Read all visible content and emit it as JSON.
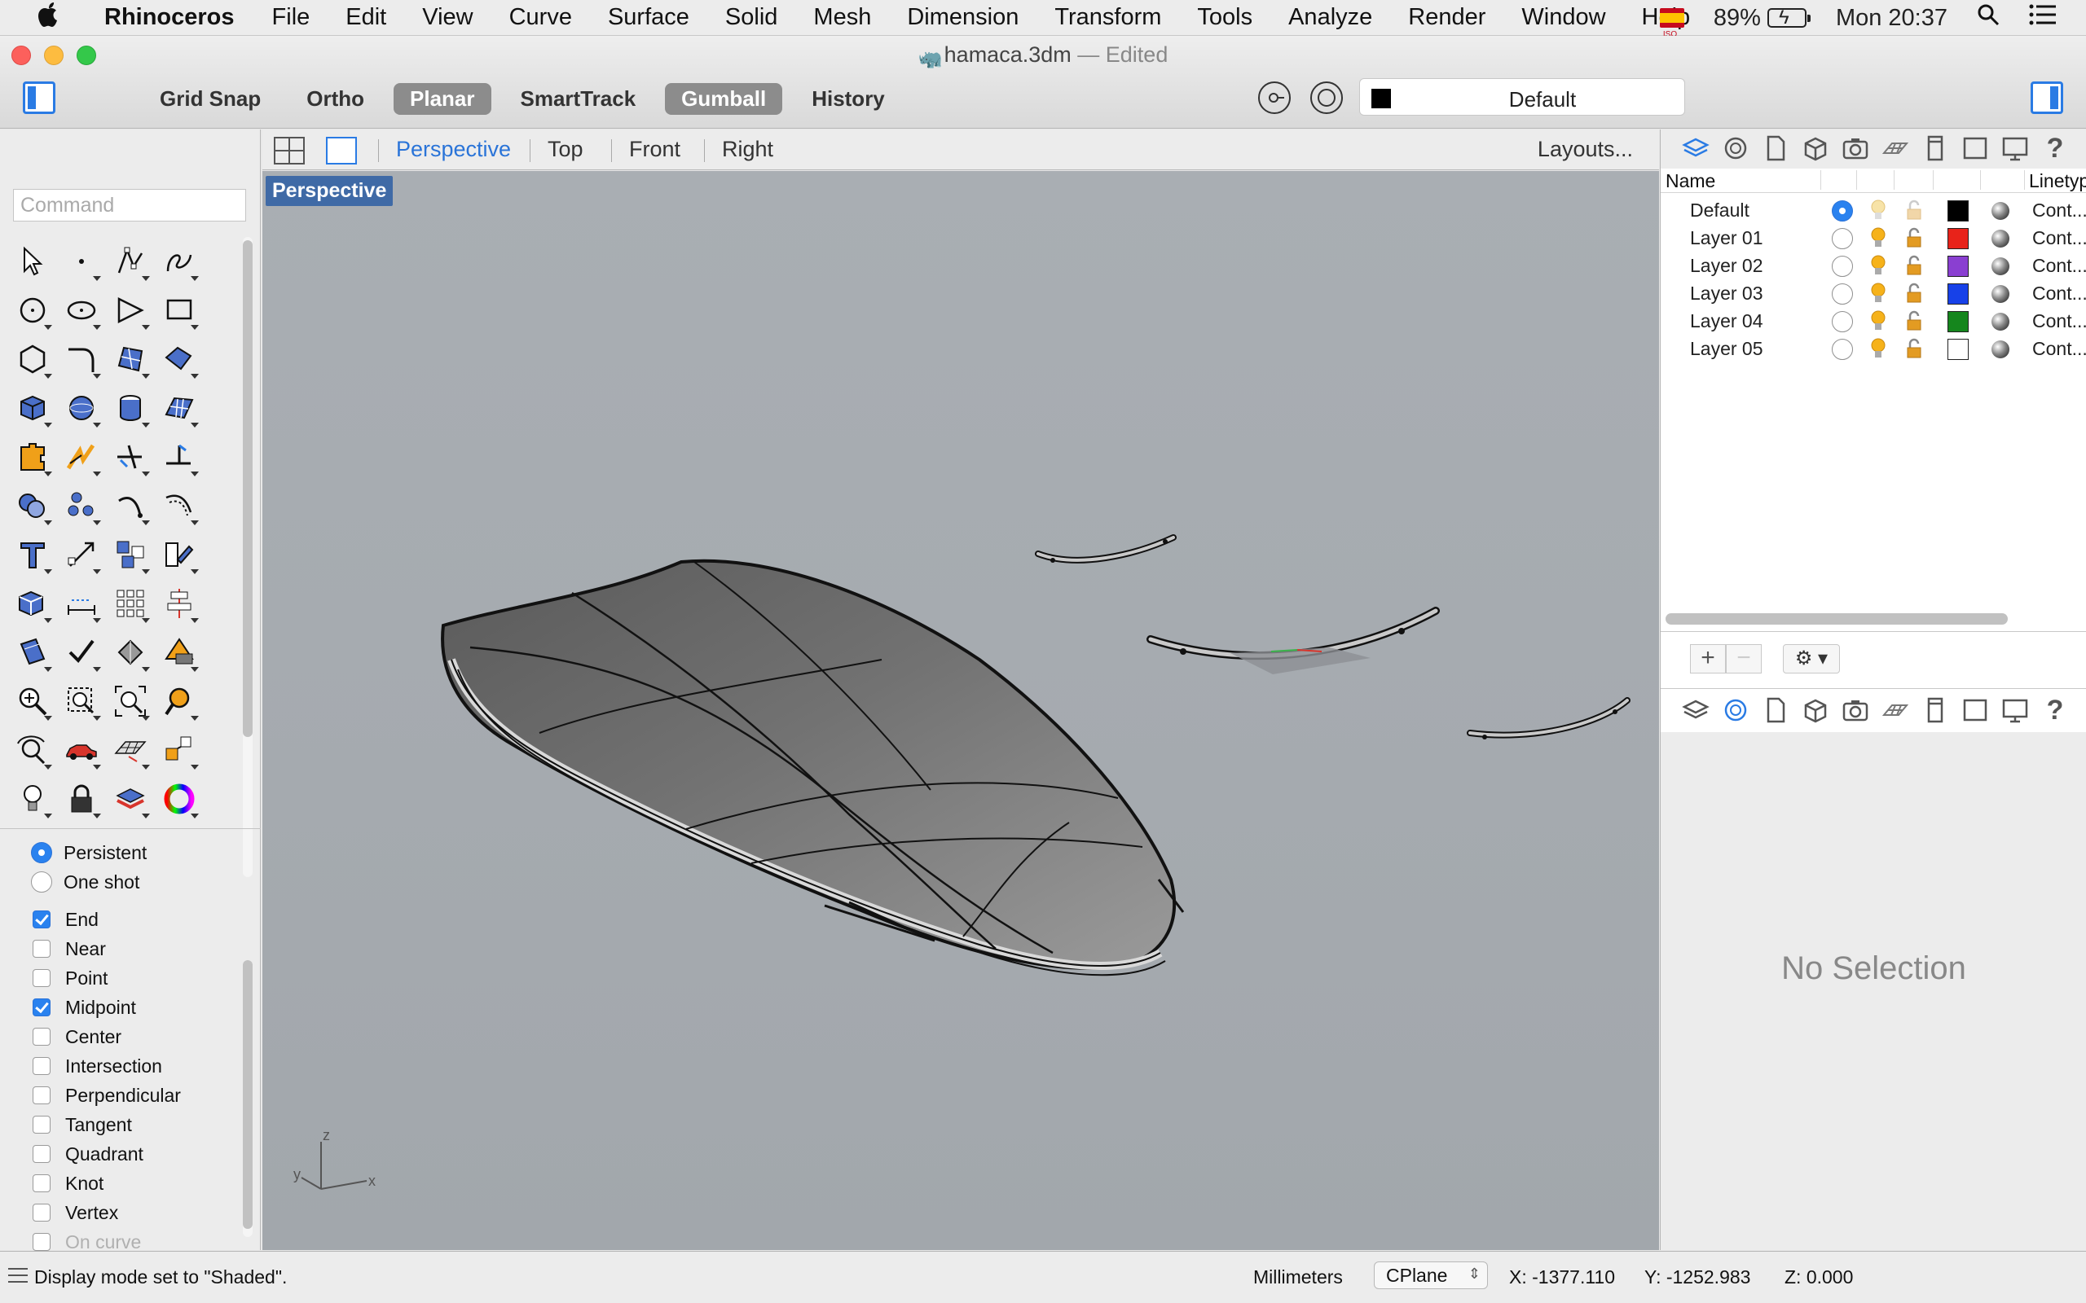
{
  "menubar": {
    "app_name": "Rhinoceros",
    "items": [
      "File",
      "Edit",
      "View",
      "Curve",
      "Surface",
      "Solid",
      "Mesh",
      "Dimension",
      "Transform",
      "Tools",
      "Analyze",
      "Render",
      "Window",
      "Help"
    ],
    "battery": "89%",
    "clock": "Mon 20:37",
    "flag_text": "ISO"
  },
  "window": {
    "filename": "hamaca.3dm",
    "separator": "—",
    "state": "Edited"
  },
  "toolbar": {
    "toggles": [
      {
        "label": "Grid Snap",
        "on": false
      },
      {
        "label": "Ortho",
        "on": false
      },
      {
        "label": "Planar",
        "on": true
      },
      {
        "label": "SmartTrack",
        "on": false
      },
      {
        "label": "Gumball",
        "on": true
      },
      {
        "label": "History",
        "on": false
      }
    ],
    "current_layer": "Default",
    "current_layer_color": "#000000"
  },
  "command": {
    "placeholder": "Command"
  },
  "tools": [
    {
      "icon": "select-arrow-icon",
      "menu": false
    },
    {
      "icon": "point-icon",
      "menu": true
    },
    {
      "icon": "polyline-icon",
      "menu": true
    },
    {
      "icon": "curve-icon",
      "menu": true
    },
    {
      "icon": "circle-icon",
      "menu": true
    },
    {
      "icon": "ellipse-icon",
      "menu": true
    },
    {
      "icon": "arc-icon",
      "menu": true
    },
    {
      "icon": "rectangle-icon",
      "menu": true
    },
    {
      "icon": "polygon-icon",
      "menu": true
    },
    {
      "icon": "fillet-curve-icon",
      "menu": true
    },
    {
      "icon": "surface-from-points-icon",
      "menu": true
    },
    {
      "icon": "extrude-surface-icon",
      "menu": true
    },
    {
      "icon": "box-icon",
      "menu": true
    },
    {
      "icon": "sphere-icon",
      "menu": true
    },
    {
      "icon": "cylinder-icon",
      "menu": true
    },
    {
      "icon": "mesh-plane-icon",
      "menu": true
    },
    {
      "icon": "puzzle-icon",
      "menu": true
    },
    {
      "icon": "explode-icon",
      "menu": true
    },
    {
      "icon": "trim-icon",
      "menu": true
    },
    {
      "icon": "split-icon",
      "menu": true
    },
    {
      "icon": "boolean-union-icon",
      "menu": true
    },
    {
      "icon": "points-icon",
      "menu": true
    },
    {
      "icon": "rebuild-curve-icon",
      "menu": true
    },
    {
      "icon": "offset-curve-icon",
      "menu": true
    },
    {
      "icon": "text-icon",
      "menu": true
    },
    {
      "icon": "move-icon",
      "menu": true
    },
    {
      "icon": "array-icon",
      "menu": true
    },
    {
      "icon": "edit-icon",
      "menu": true
    },
    {
      "icon": "block-icon",
      "menu": true
    },
    {
      "icon": "dimension-icon",
      "menu": true
    },
    {
      "icon": "grid-array-icon",
      "menu": true
    },
    {
      "icon": "align-icon",
      "menu": true
    },
    {
      "icon": "analyze-icon",
      "menu": true
    },
    {
      "icon": "check-icon",
      "menu": true
    },
    {
      "icon": "shade-icon",
      "menu": true
    },
    {
      "icon": "render-icon",
      "menu": true
    },
    {
      "icon": "zoom-in-icon",
      "menu": true
    },
    {
      "icon": "zoom-window-icon",
      "menu": true
    },
    {
      "icon": "zoom-extents-icon",
      "menu": true
    },
    {
      "icon": "zoom-selected-icon",
      "menu": true
    },
    {
      "icon": "rotate-view-icon",
      "menu": true
    },
    {
      "icon": "car-icon",
      "menu": true
    },
    {
      "icon": "grid-plane-icon",
      "menu": true
    },
    {
      "icon": "transform-icon",
      "menu": true
    },
    {
      "icon": "light-bulb-icon",
      "menu": true
    },
    {
      "icon": "lock-icon",
      "menu": true
    },
    {
      "icon": "layer-stack-icon",
      "menu": true
    },
    {
      "icon": "color-wheel-icon",
      "menu": true
    }
  ],
  "osnap": {
    "modes": [
      {
        "label": "Persistent",
        "on": true
      },
      {
        "label": "One shot",
        "on": false
      }
    ],
    "snaps": [
      {
        "label": "End",
        "on": true
      },
      {
        "label": "Near",
        "on": false
      },
      {
        "label": "Point",
        "on": false
      },
      {
        "label": "Midpoint",
        "on": true
      },
      {
        "label": "Center",
        "on": false
      },
      {
        "label": "Intersection",
        "on": false
      },
      {
        "label": "Perpendicular",
        "on": false
      },
      {
        "label": "Tangent",
        "on": false
      },
      {
        "label": "Quadrant",
        "on": false
      },
      {
        "label": "Knot",
        "on": false
      },
      {
        "label": "Vertex",
        "on": false
      },
      {
        "label": "On curve",
        "on": false,
        "dim": true
      }
    ]
  },
  "viewport_tabs": {
    "tabs": [
      "Perspective",
      "Top",
      "Front",
      "Right"
    ],
    "active": "Perspective",
    "layouts": "Layouts..."
  },
  "viewport": {
    "label": "Perspective",
    "axis_labels": {
      "z": "z",
      "y": "y",
      "x": "x"
    }
  },
  "layers": {
    "columns": {
      "name": "Name",
      "linetype": "Linetyp"
    },
    "rows": [
      {
        "name": "Default",
        "current": true,
        "bulb_on": false,
        "locked": false,
        "color": "#000000",
        "linetype": "Cont..."
      },
      {
        "name": "Layer 01",
        "current": false,
        "bulb_on": true,
        "locked": true,
        "color": "#e8231a",
        "linetype": "Cont..."
      },
      {
        "name": "Layer 02",
        "current": false,
        "bulb_on": true,
        "locked": true,
        "color": "#8a3fd1",
        "linetype": "Cont..."
      },
      {
        "name": "Layer 03",
        "current": false,
        "bulb_on": true,
        "locked": true,
        "color": "#1741e8",
        "linetype": "Cont..."
      },
      {
        "name": "Layer 04",
        "current": false,
        "bulb_on": true,
        "locked": true,
        "color": "#15861d",
        "linetype": "Cont..."
      },
      {
        "name": "Layer 05",
        "current": false,
        "bulb_on": true,
        "locked": true,
        "color": "#ffffff",
        "linetype": "Cont..."
      }
    ],
    "add_label": "+",
    "remove_label": "−",
    "gear_label": "⚙ ▾"
  },
  "properties": {
    "message": "No Selection"
  },
  "status": {
    "message": "Display mode set to \"Shaded\".",
    "units": "Millimeters",
    "cplane": "CPlane",
    "x": "X: -1377.110",
    "y": "Y: -1252.983",
    "z": "Z: 0.000"
  }
}
